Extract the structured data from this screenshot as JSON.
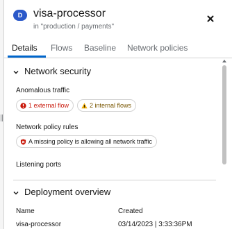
{
  "header": {
    "badge": "D",
    "title": "visa-processor",
    "subtitle": "in \"production / payments\""
  },
  "tabs": [
    {
      "label": "Details",
      "active": true
    },
    {
      "label": "Flows",
      "active": false
    },
    {
      "label": "Baseline",
      "active": false
    },
    {
      "label": "Network policies",
      "active": false
    }
  ],
  "network_security": {
    "title": "Network security",
    "anomalous_traffic": {
      "label": "Anomalous traffic",
      "external_flow": "1 external flow",
      "internal_flows": "2 internal flows"
    },
    "network_policy_rules": {
      "label": "Network policy rules",
      "message": "A missing policy is allowing all network traffic"
    },
    "listening_ports": {
      "label": "Listening ports"
    }
  },
  "deployment_overview": {
    "title": "Deployment overview",
    "columns": [
      {
        "header": "Name",
        "value": "visa-processor"
      },
      {
        "header": "Created",
        "value": "03/14/2023 | 3:33:36PM"
      }
    ]
  },
  "colors": {
    "accent": "#0066cc",
    "badge": "#2b59c9",
    "danger": "#c9190b",
    "warning": "#f0ab00"
  }
}
